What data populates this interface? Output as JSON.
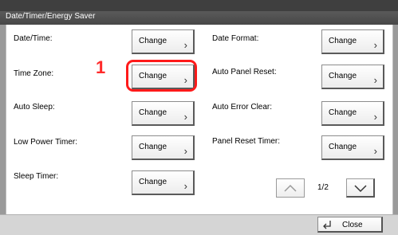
{
  "window": {
    "title": "Date/Timer/Energy Saver"
  },
  "left_settings": [
    {
      "label": "Date/Time:",
      "button": "Change"
    },
    {
      "label": "Time Zone:",
      "button": "Change"
    },
    {
      "label": "Auto Sleep:",
      "button": "Change"
    },
    {
      "label": "Low Power Timer:",
      "button": "Change"
    },
    {
      "label": "Sleep Timer:",
      "button": "Change"
    }
  ],
  "right_settings": [
    {
      "label": "Date Format:",
      "button": "Change"
    },
    {
      "label": "Auto Panel Reset:",
      "button": "Change"
    },
    {
      "label": "Auto Error Clear:",
      "button": "Change"
    },
    {
      "label": "Panel Reset Timer:",
      "button": "Change"
    }
  ],
  "callout": {
    "step": "1",
    "color": "#ff1a1a"
  },
  "pagination": {
    "indicator": "1/2"
  },
  "footer": {
    "close_label": "Close"
  },
  "icons": {
    "button_arrow": "chevron-right-icon",
    "page_up": "chevron-up-icon",
    "page_down": "chevron-down-icon",
    "close": "return-arrow-icon"
  }
}
